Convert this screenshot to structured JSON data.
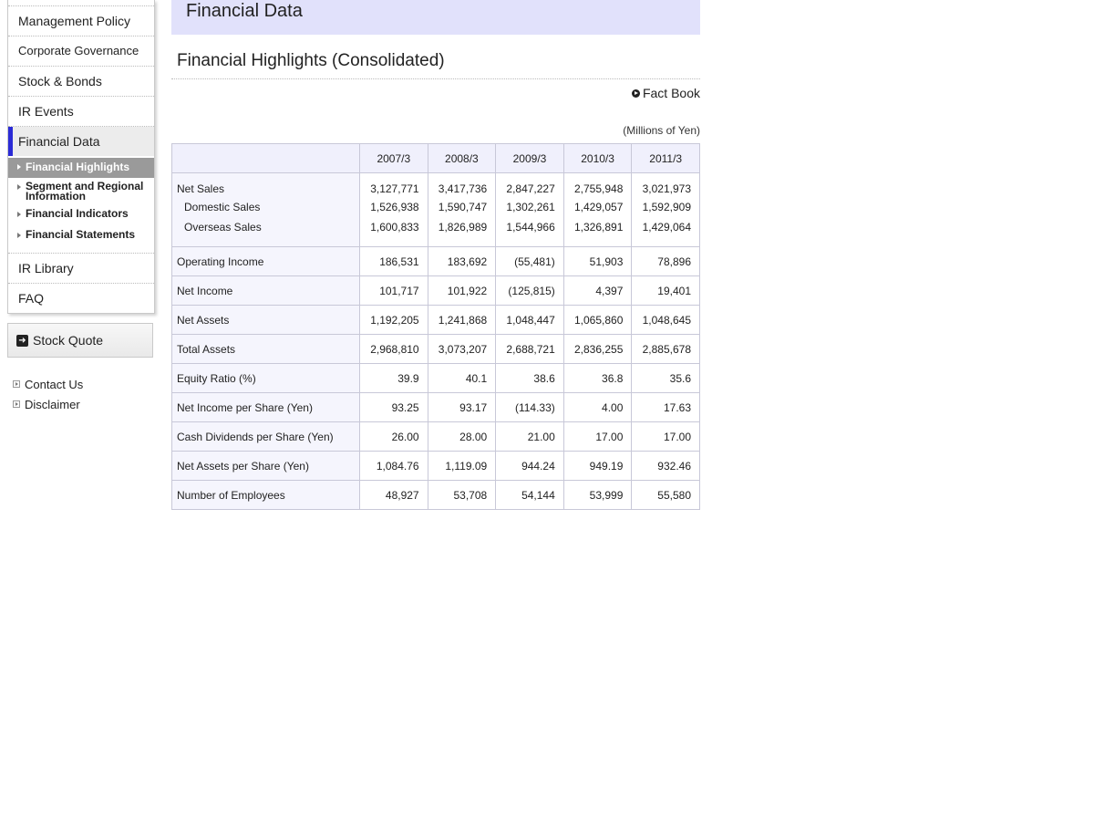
{
  "sidebar": {
    "items": [
      {
        "label": "Management Policy"
      },
      {
        "label": "Corporate Governance"
      },
      {
        "label": "Stock & Bonds"
      },
      {
        "label": "IR Events"
      },
      {
        "label": "Financial Data"
      },
      {
        "label": "IR Library"
      },
      {
        "label": "FAQ"
      }
    ],
    "sub_items": [
      {
        "label": "Financial Highlights"
      },
      {
        "label": "Segment and Regional",
        "label2": "Information"
      },
      {
        "label": "Financial Indicators"
      },
      {
        "label": "Financial Statements"
      }
    ],
    "stock_quote": "Stock Quote",
    "contact_us": "Contact Us",
    "disclaimer": "Disclaimer"
  },
  "main": {
    "header": "Financial Data",
    "section_title": "Financial Highlights (Consolidated)",
    "fact_book": "Fact Book",
    "units": "(Millions of Yen)"
  },
  "table": {
    "columns": [
      "2007/3",
      "2008/3",
      "2009/3",
      "2010/3",
      "2011/3"
    ],
    "sales": {
      "labels": [
        "Net Sales",
        "Domestic Sales",
        "Overseas Sales"
      ],
      "values": [
        [
          "3,127,771",
          "1,526,938",
          "1,600,833"
        ],
        [
          "3,417,736",
          "1,590,747",
          "1,826,989"
        ],
        [
          "2,847,227",
          "1,302,261",
          "1,544,966"
        ],
        [
          "2,755,948",
          "1,429,057",
          "1,326,891"
        ],
        [
          "3,021,973",
          "1,592,909",
          "1,429,064"
        ]
      ]
    },
    "rows": [
      {
        "label": "Operating Income",
        "values": [
          "186,531",
          "183,692",
          "(55,481)",
          "51,903",
          "78,896"
        ]
      },
      {
        "label": "Net Income",
        "values": [
          "101,717",
          "101,922",
          "(125,815)",
          "4,397",
          "19,401"
        ]
      },
      {
        "label": "Net Assets",
        "values": [
          "1,192,205",
          "1,241,868",
          "1,048,447",
          "1,065,860",
          "1,048,645"
        ]
      },
      {
        "label": "Total Assets",
        "values": [
          "2,968,810",
          "3,073,207",
          "2,688,721",
          "2,836,255",
          "2,885,678"
        ]
      },
      {
        "label": "Equity Ratio (%)",
        "values": [
          "39.9",
          "40.1",
          "38.6",
          "36.8",
          "35.6"
        ]
      },
      {
        "label": "Net Income per Share (Yen)",
        "values": [
          "93.25",
          "93.17",
          "(114.33)",
          "4.00",
          "17.63"
        ]
      },
      {
        "label": "Cash Dividends per Share (Yen)",
        "values": [
          "26.00",
          "28.00",
          "21.00",
          "17.00",
          "17.00"
        ]
      },
      {
        "label": "Net Assets per Share (Yen)",
        "values": [
          "1,084.76",
          "1,119.09",
          "944.24",
          "949.19",
          "932.46"
        ]
      },
      {
        "label": "Number of Employees",
        "values": [
          "48,927",
          "53,708",
          "54,144",
          "53,999",
          "55,580"
        ]
      }
    ]
  },
  "colors": {
    "header_band": "#e1e1fb",
    "active_accent": "#2b2bd6",
    "selected_sub": "#9a9a9a"
  }
}
